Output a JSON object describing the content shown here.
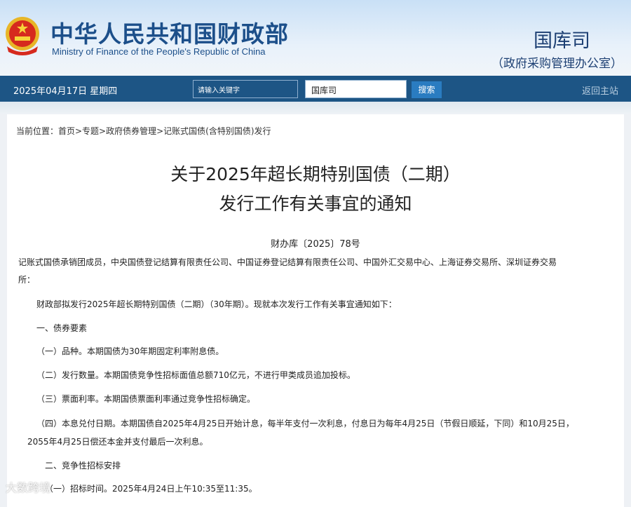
{
  "header": {
    "title_cn": "中华人民共和国财政部",
    "title_en": "Ministry of Finance of the People's Republic of China",
    "dept": "国库司",
    "dept_sub": "（政府采购管理办公室）"
  },
  "nav": {
    "date": "2025年04月17日  星期四",
    "search_placeholder": "请输入关键字",
    "scope": "国库司",
    "search_button": "搜索",
    "home_link": "返回主站"
  },
  "breadcrumb": "当前位置：首页>专题>政府债券管理>记账式国债(含特别国债)发行",
  "article": {
    "title_line1": "关于2025年超长期特别国债（二期）",
    "title_line2": "发行工作有关事宜的通知",
    "doc_no": "财办库〔2025〕78号",
    "paragraphs": [
      "记账式国债承销团成员，中央国债登记结算有限责任公司、中国证券登记结算有限责任公司、中国外汇交易中心、上海证券交易所、深圳证券交易",
      "所：",
      "财政部拟发行2025年超长期特别国债（二期）（30年期）。现就本次发行工作有关事宜通知如下：",
      "一、债券要素",
      "（一）品种。本期国债为30年期固定利率附息债。",
      "（二）发行数量。本期国债竞争性招标面值总额710亿元，不进行甲类成员追加投标。",
      "（三）票面利率。本期国债票面利率通过竞争性招标确定。",
      "（四）本息兑付日期。本期国债自2025年4月25日开始计息，每半年支付一次利息，付息日为每年4月25日（节假日顺延，下同）和10月25日，",
      "2055年4月25日偿还本金并支付最后一次利息。",
      "二、竞争性招标安排",
      "（一）招标时间。2025年4月24日上午10:35至11:35。"
    ]
  },
  "watermark": "大数跨境"
}
